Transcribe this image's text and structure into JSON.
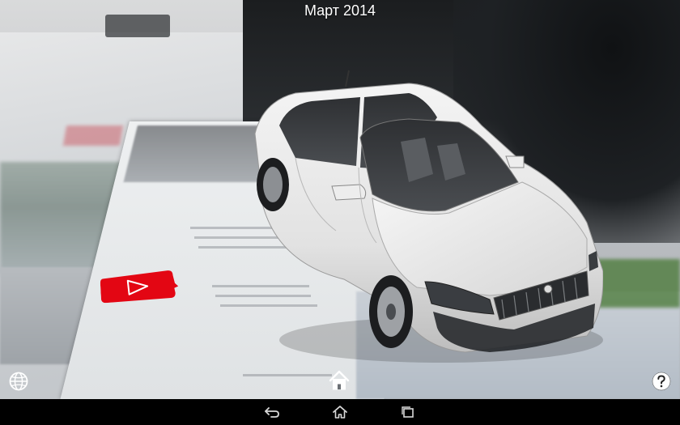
{
  "header": {
    "title": "Март 2014"
  },
  "ar_marker": {
    "icon": "play-icon",
    "color": "#e30613"
  },
  "overlay": {
    "language_icon": "globe-icon",
    "home_icon": "home-icon",
    "help_icon": "help-icon"
  },
  "nav_bar": {
    "back_icon": "back-icon",
    "home_icon": "nav-home-icon",
    "recents_icon": "recents-icon"
  }
}
